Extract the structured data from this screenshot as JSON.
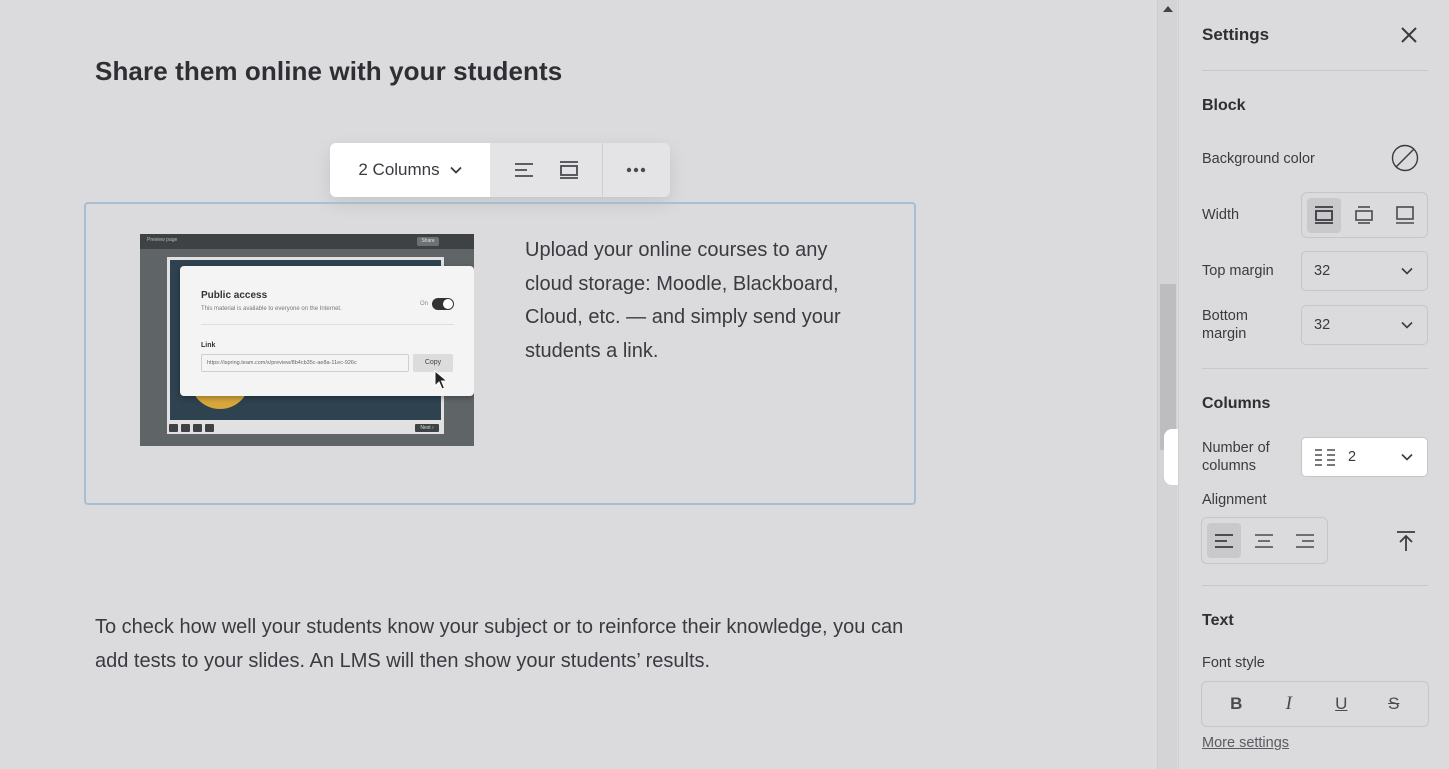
{
  "editor": {
    "heading": "Share them online with your students",
    "toolbar": {
      "columns_label": "2 Columns",
      "icons": [
        "align-left-icon",
        "block-width-icon",
        "more-icon"
      ]
    },
    "column_text": "Upload your online courses to any cloud storage: Moodle, Blackboard, Cloud, etc. — and simply send your students a link.",
    "paragraph": "To check how well your students know your subject or to reinforce their knowledge, you can add tests to your slides. An LMS will then show your students’ results.",
    "thumbnail": {
      "window_title": "Preview page",
      "share_label": "Share",
      "dialog_title": "Public access",
      "dialog_subtitle": "This material is available to everyone on the Internet.",
      "toggle_label": "On",
      "link_label": "Link",
      "url": "https://ispring.team.com/s/preview/8b4cb35c-ae8a-11ec-926c",
      "copy_label": "Copy",
      "next_label": "Next ›"
    }
  },
  "settings": {
    "title": "Settings",
    "block": {
      "section_title": "Block",
      "background_color_label": "Background color",
      "width_label": "Width",
      "top_margin_label": "Top margin",
      "top_margin_value": "32",
      "bottom_margin_label": "Bottom margin",
      "bottom_margin_value": "32"
    },
    "columns": {
      "section_title": "Columns",
      "number_label": "Number of columns",
      "number_value": "2",
      "alignment_label": "Alignment"
    },
    "text": {
      "section_title": "Text",
      "font_style_label": "Font style",
      "font_buttons": [
        "B",
        "I",
        "U",
        "S"
      ],
      "more_settings_label": "More settings"
    }
  },
  "colors": {
    "canvas_bg": "#dbdbdd",
    "block_border": "#a9bdd3",
    "active_segment": "#c9c9cc",
    "highlight": "#ffffff"
  }
}
